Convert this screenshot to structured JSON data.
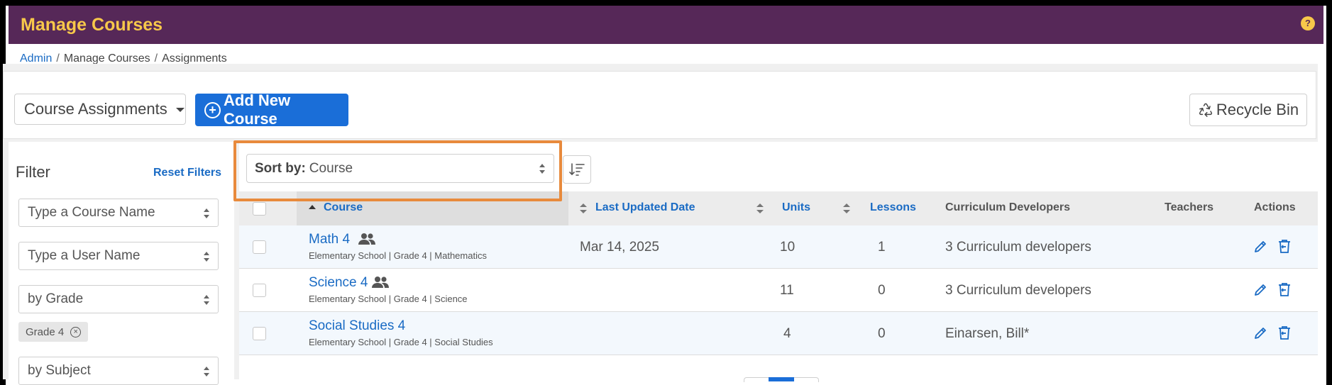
{
  "app": {
    "title": "Manage Courses",
    "help_icon_label": "?"
  },
  "breadcrumb": {
    "items": [
      "Admin",
      "Manage Courses",
      "Assignments"
    ]
  },
  "toolbar": {
    "view_select": "Course Assignments",
    "add_button": "Add New Course",
    "recycle_button": "Recycle Bin"
  },
  "filter": {
    "title": "Filter",
    "reset": "Reset Filters",
    "course_name_placeholder": "Type a Course Name",
    "user_name_placeholder": "Type a User Name",
    "grade_select": "by Grade",
    "grade_chip": "Grade 4",
    "subject_select": "by Subject"
  },
  "sort": {
    "label": "Sort by:",
    "value": "Course"
  },
  "table": {
    "headers": {
      "course": "Course",
      "last_updated": "Last Updated Date",
      "units": "Units",
      "lessons": "Lessons",
      "developers": "Curriculum Developers",
      "teachers": "Teachers",
      "actions": "Actions"
    },
    "rows": [
      {
        "course": "Math 4",
        "sub": "Elementary School | Grade 4 | Mathematics",
        "last_updated": "Mar 14, 2025",
        "units": "10",
        "lessons": "1",
        "developers": "3 Curriculum developers",
        "teachers": ""
      },
      {
        "course": "Science 4",
        "sub": "Elementary School | Grade 4 | Science",
        "last_updated": "",
        "units": "11",
        "lessons": "0",
        "developers": "3 Curriculum developers",
        "teachers": ""
      },
      {
        "course": "Social Studies 4",
        "sub": "Elementary School | Grade 4 | Social Studies",
        "last_updated": "",
        "units": "4",
        "lessons": "0",
        "developers": "Einarsen, Bill*",
        "teachers": ""
      }
    ]
  },
  "colors": {
    "header_bg": "#562858",
    "title_text": "#f7c84a",
    "primary": "#1a6ed8",
    "link": "#1a6bc4",
    "highlight": "#e88a3c"
  }
}
